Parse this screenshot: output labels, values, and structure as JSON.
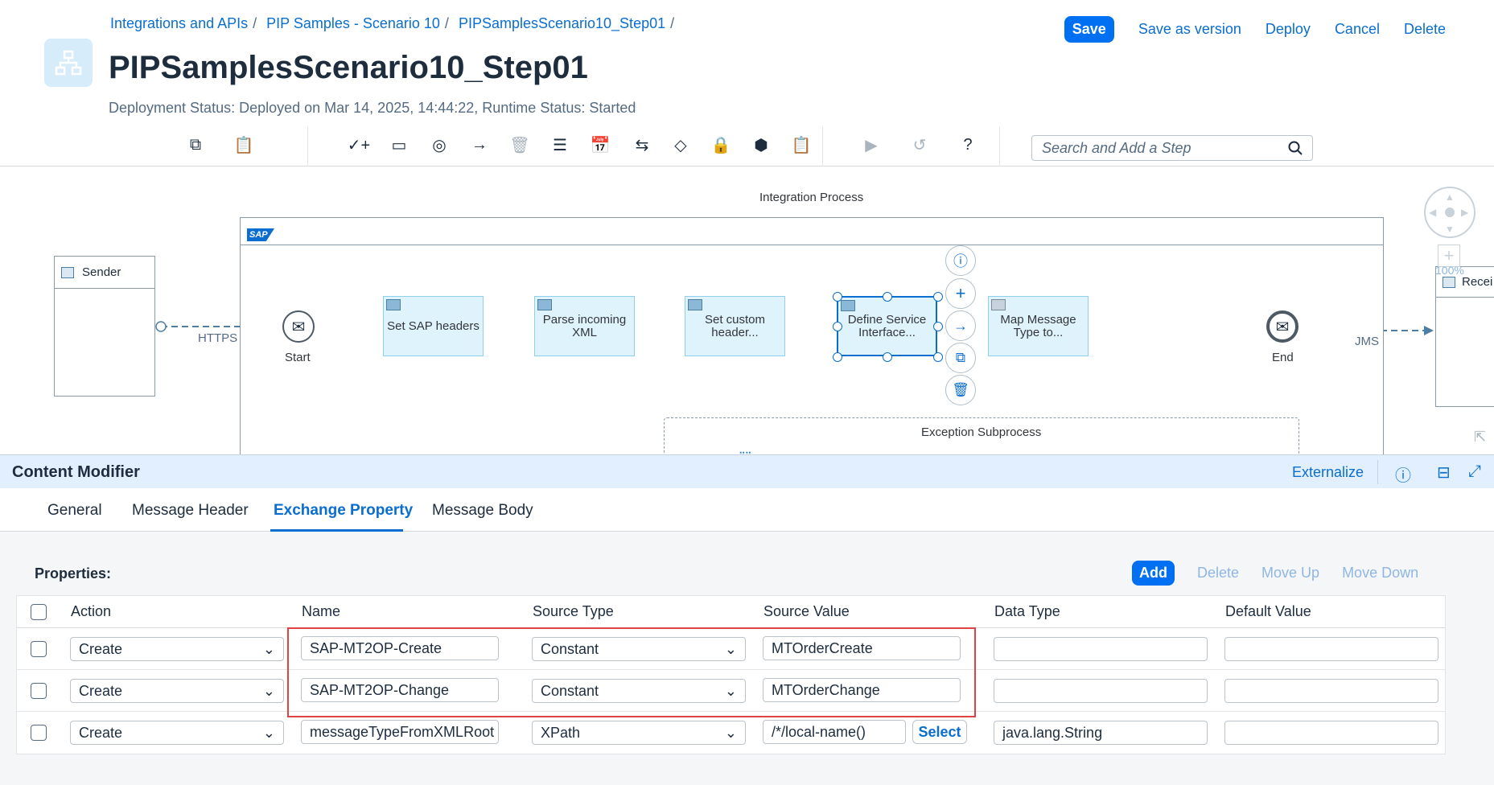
{
  "breadcrumb": [
    "Integrations and APIs",
    "PIP Samples - Scenario 10",
    "PIPSamplesScenario10_Step01"
  ],
  "breadcrumb_separator": "/",
  "title": "PIPSamplesScenario10_Step01",
  "status": "Deployment Status: Deployed on Mar 14, 2025, 14:44:22, Runtime Status: Started",
  "actions": {
    "save": "Save",
    "save_as_version": "Save as version",
    "deploy": "Deploy",
    "cancel": "Cancel",
    "delete": "Delete"
  },
  "search": {
    "placeholder": "Search and Add a Step"
  },
  "canvas": {
    "sender": "Sender",
    "integration_process": "Integration Process",
    "sender_adapter": "HTTPS",
    "receiver_adapter": "JMS",
    "receiver": "Recei",
    "zoom": "100%",
    "start": "Start",
    "end": "End",
    "exception_subprocess": "Exception Subprocess",
    "sap_logo": "SAP",
    "steps": [
      {
        "label": "Set SAP headers"
      },
      {
        "label": "Parse incoming XML"
      },
      {
        "label": "Set custom header..."
      },
      {
        "label": "Define Service Interface..."
      },
      {
        "label": "Map Message Type to..."
      }
    ]
  },
  "panel": {
    "title": "Content Modifier",
    "externalize": "Externalize",
    "tabs": [
      "General",
      "Message Header",
      "Exchange Property",
      "Message Body"
    ],
    "active_tab": "Exchange Property",
    "properties_label": "Properties:",
    "table_actions": {
      "add": "Add",
      "delete": "Delete",
      "move_up": "Move Up",
      "move_down": "Move Down"
    },
    "columns": [
      "Action",
      "Name",
      "Source Type",
      "Source Value",
      "Data Type",
      "Default Value"
    ],
    "rows": [
      {
        "action": "Create",
        "name": "SAP-MT2OP-Create",
        "source_type": "Constant",
        "source_value": "MTOrderCreate",
        "data_type": "",
        "default_value": ""
      },
      {
        "action": "Create",
        "name": "SAP-MT2OP-Change",
        "source_type": "Constant",
        "source_value": "MTOrderChange",
        "data_type": "",
        "default_value": ""
      },
      {
        "action": "Create",
        "name": "messageTypeFromXMLRoot",
        "source_type": "XPath",
        "source_value": "/*/local-name()",
        "select_label": "Select",
        "data_type": "java.lang.String",
        "default_value": ""
      }
    ]
  },
  "colors": {
    "accent": "#0a6ed1",
    "primary_button": "#0070f2",
    "highlight": "#e04343",
    "step_fill": "#dff3fd"
  }
}
